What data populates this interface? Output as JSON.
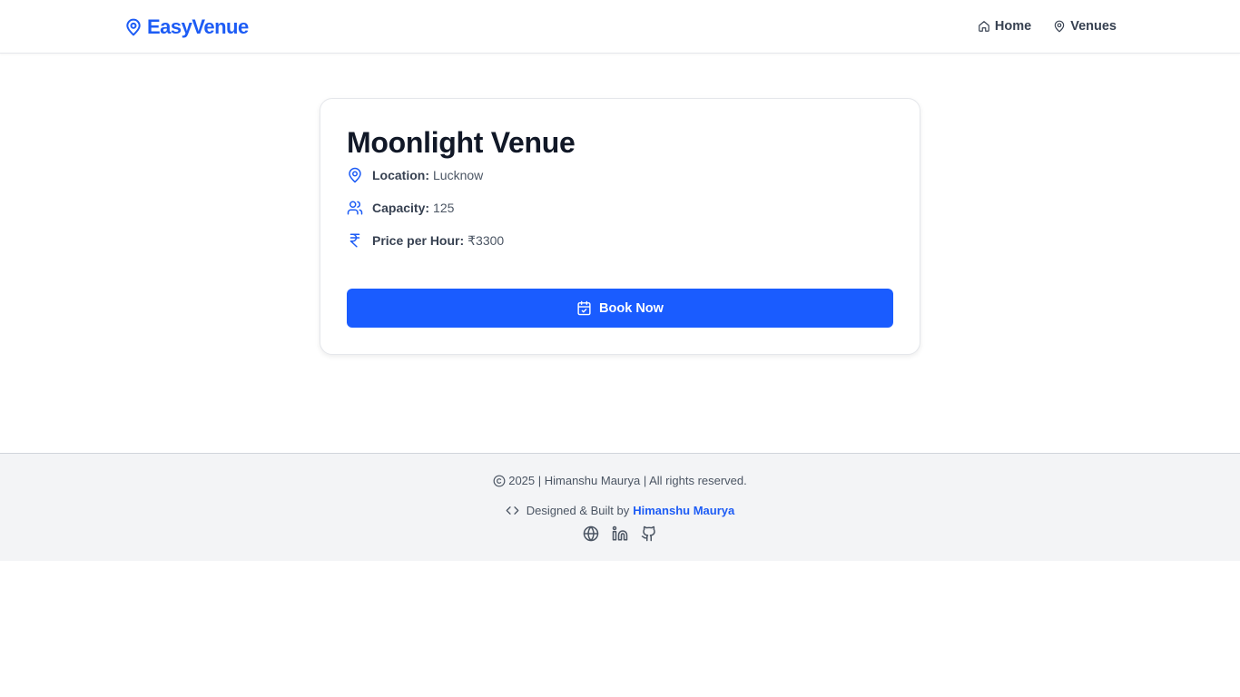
{
  "brand": {
    "name": "EasyVenue",
    "icon": "map-pin-icon",
    "color": "#1d5cf5"
  },
  "nav": {
    "items": [
      {
        "label": "Home",
        "icon": "home-icon"
      },
      {
        "label": "Venues",
        "icon": "map-pin-icon"
      }
    ]
  },
  "venue": {
    "name": "Moonlight Venue",
    "details": [
      {
        "label": "Location:",
        "value": "Lucknow",
        "icon": "map-pin-icon"
      },
      {
        "label": "Capacity:",
        "value": "125",
        "icon": "users-icon"
      },
      {
        "label": "Price per Hour:",
        "value": "₹3300",
        "icon": "rupee-icon"
      }
    ],
    "book_label": "Book Now",
    "book_icon": "calendar-check-icon",
    "accent": "#1a5cff"
  },
  "footer": {
    "copyright": "2025 | Himanshu Maurya | All rights reserved.",
    "credit_prefix": "Designed & Built by",
    "credit_author": "Himanshu Maurya",
    "socials": [
      "globe-icon",
      "linkedin-icon",
      "github-icon"
    ]
  }
}
